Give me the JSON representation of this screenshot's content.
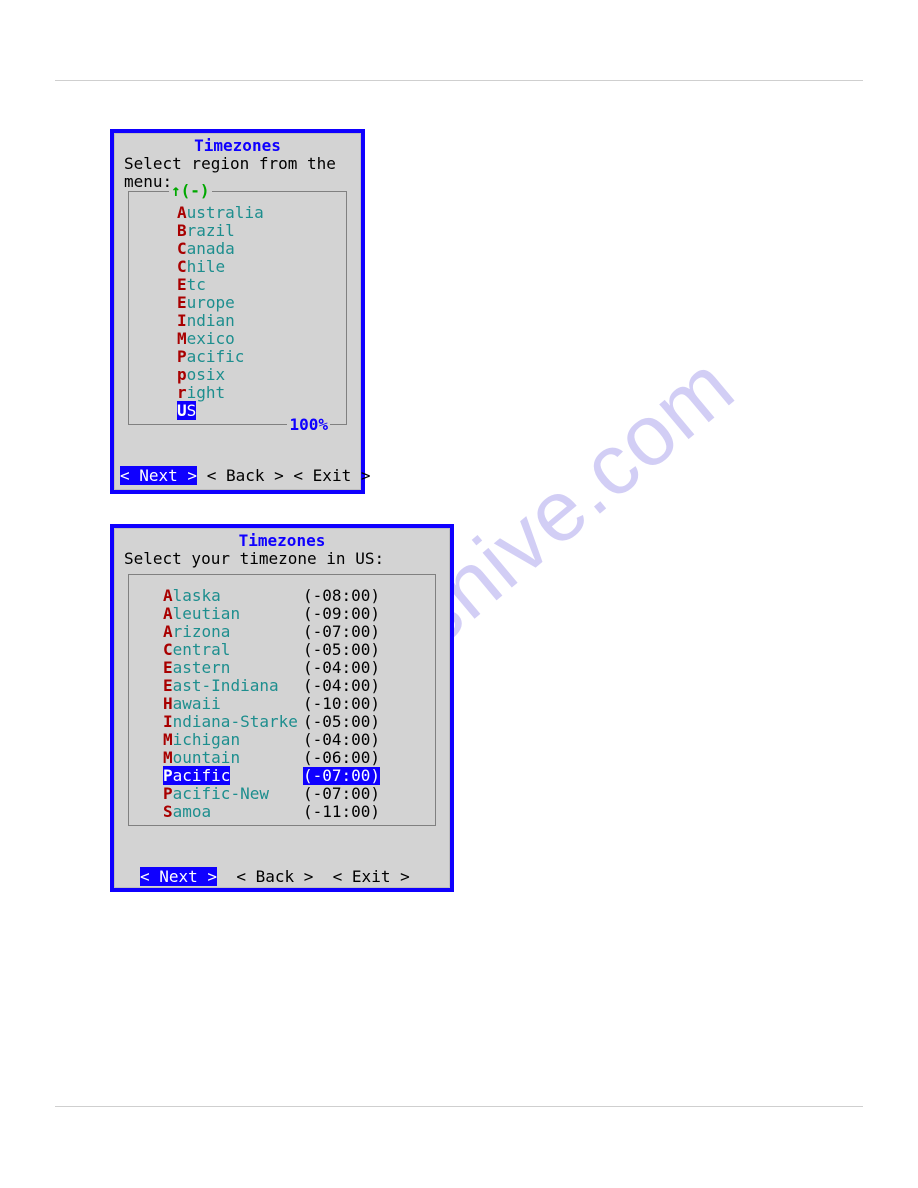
{
  "watermark": "manualshive.com",
  "dialog1": {
    "title": "Timezones",
    "prompt": "Select region from the\nmenu:",
    "scroll_indicator": "↑(-)",
    "percent": "100%",
    "items": [
      {
        "hotkey": "A",
        "rest": "ustralia",
        "selected": false
      },
      {
        "hotkey": "B",
        "rest": "razil",
        "selected": false
      },
      {
        "hotkey": "C",
        "rest": "anada",
        "selected": false
      },
      {
        "hotkey": "C",
        "rest": "hile",
        "selected": false
      },
      {
        "hotkey": "E",
        "rest": "tc",
        "selected": false
      },
      {
        "hotkey": "E",
        "rest": "urope",
        "selected": false
      },
      {
        "hotkey": "I",
        "rest": "ndian",
        "selected": false
      },
      {
        "hotkey": "M",
        "rest": "exico",
        "selected": false
      },
      {
        "hotkey": "P",
        "rest": "acific",
        "selected": false
      },
      {
        "hotkey": "p",
        "rest": "osix",
        "selected": false
      },
      {
        "hotkey": "r",
        "rest": "ight",
        "selected": false
      },
      {
        "hotkey": "U",
        "rest": "S",
        "selected": true
      }
    ],
    "buttons": {
      "next": "Next",
      "back": "Back",
      "exit": "Exit"
    }
  },
  "dialog2": {
    "title": "Timezones",
    "prompt": "Select your timezone in US:",
    "items": [
      {
        "hotkey": "A",
        "rest": "laska",
        "offset": "(-08:00)",
        "selected": false
      },
      {
        "hotkey": "A",
        "rest": "leutian",
        "offset": "(-09:00)",
        "selected": false
      },
      {
        "hotkey": "A",
        "rest": "rizona",
        "offset": "(-07:00)",
        "selected": false
      },
      {
        "hotkey": "C",
        "rest": "entral",
        "offset": "(-05:00)",
        "selected": false
      },
      {
        "hotkey": "E",
        "rest": "astern",
        "offset": "(-04:00)",
        "selected": false
      },
      {
        "hotkey": "E",
        "rest": "ast-Indiana",
        "offset": "(-04:00)",
        "selected": false
      },
      {
        "hotkey": "H",
        "rest": "awaii",
        "offset": "(-10:00)",
        "selected": false
      },
      {
        "hotkey": "I",
        "rest": "ndiana-Starke",
        "offset": "(-05:00)",
        "selected": false
      },
      {
        "hotkey": "M",
        "rest": "ichigan",
        "offset": "(-04:00)",
        "selected": false
      },
      {
        "hotkey": "M",
        "rest": "ountain",
        "offset": "(-06:00)",
        "selected": false
      },
      {
        "hotkey": "P",
        "rest": "acific",
        "offset": "(-07:00)",
        "selected": true
      },
      {
        "hotkey": "P",
        "rest": "acific-New",
        "offset": "(-07:00)",
        "selected": false
      },
      {
        "hotkey": "S",
        "rest": "amoa",
        "offset": "(-11:00)",
        "selected": false
      }
    ],
    "buttons": {
      "next": "Next",
      "back": "Back",
      "exit": "Exit"
    }
  }
}
